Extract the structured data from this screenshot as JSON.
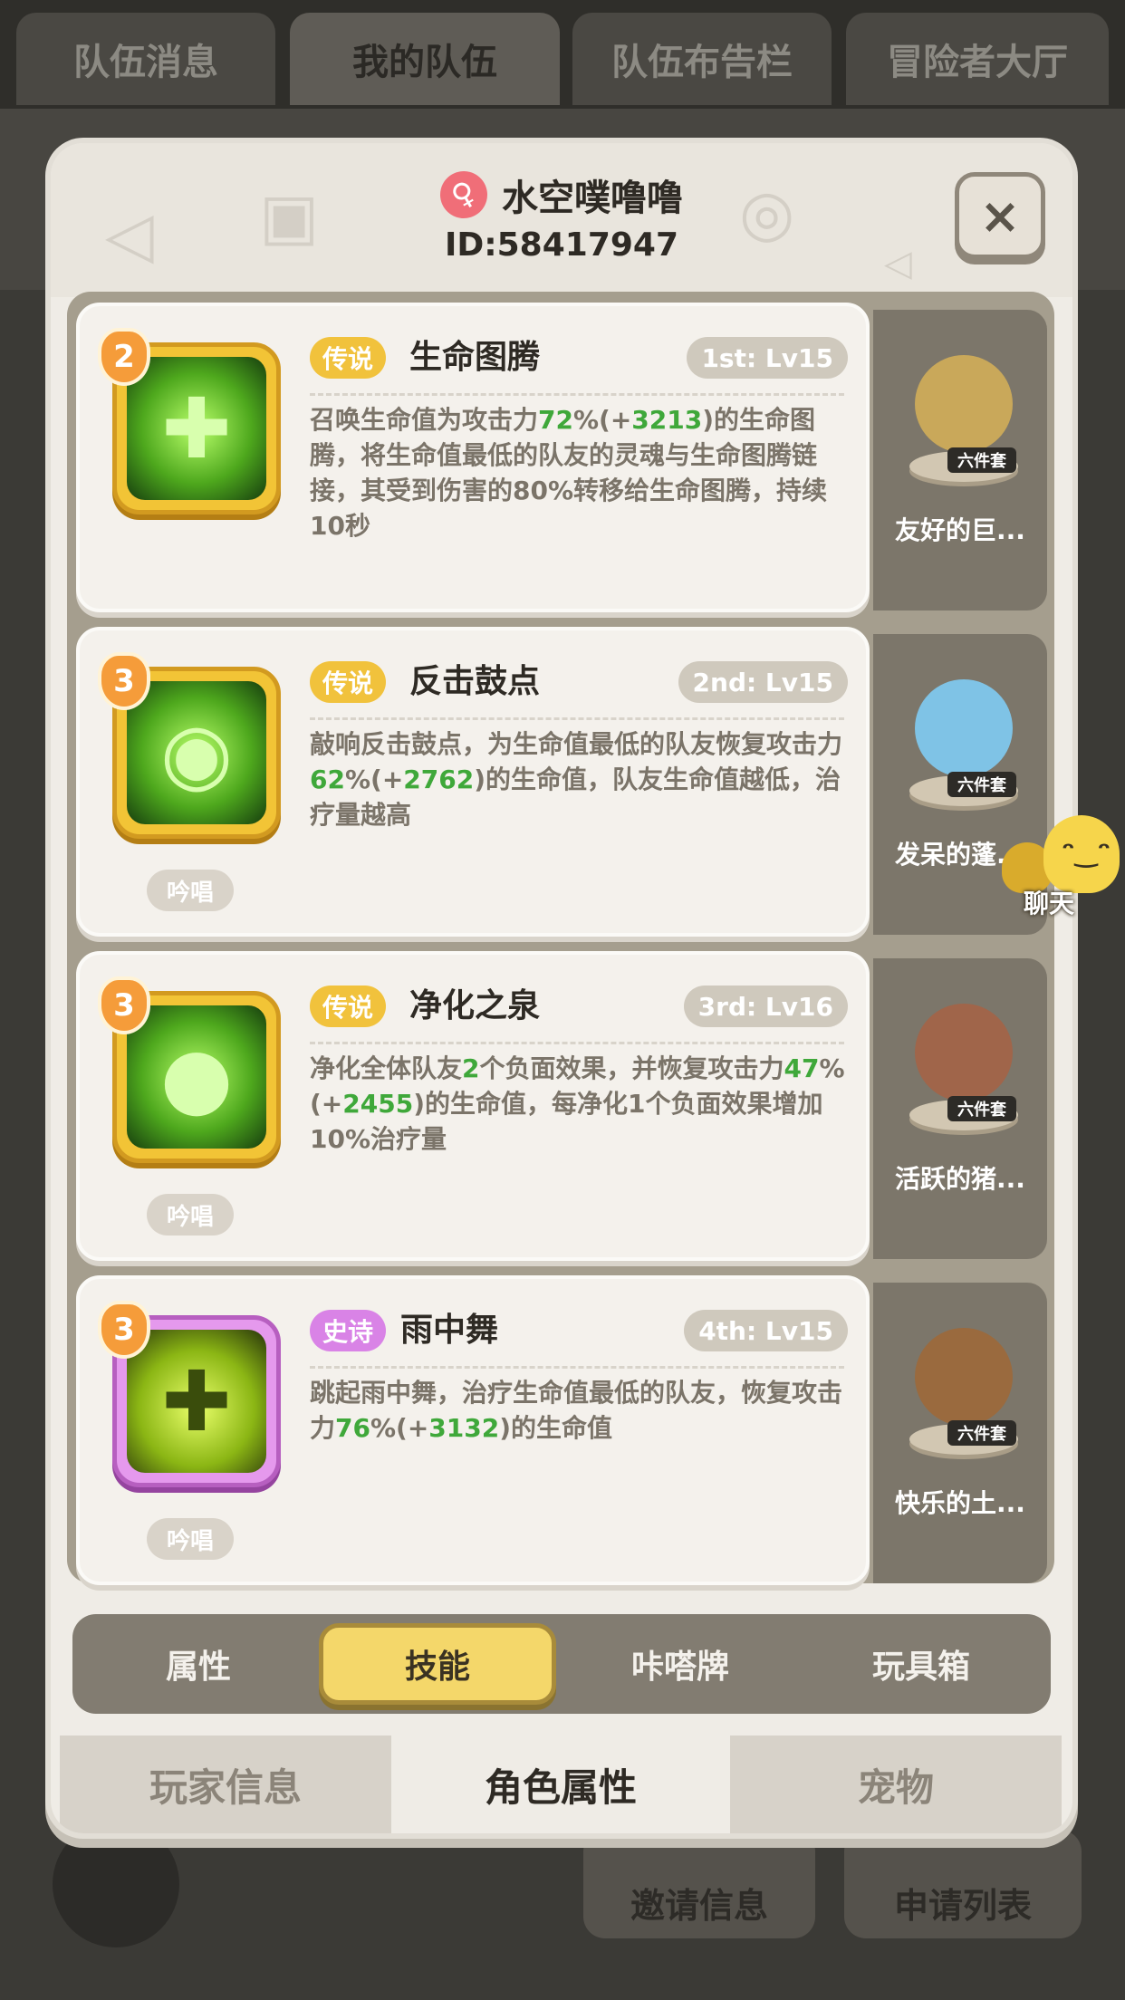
{
  "background": {
    "top_tabs": [
      "队伍消息",
      "我的队伍",
      "队伍布告栏",
      "冒险者大厅"
    ],
    "bottom_buttons": [
      "邀请信息",
      "申请列表"
    ]
  },
  "profile": {
    "name": "水空噗噜噜",
    "id": "ID:58417947",
    "close_label": "×"
  },
  "skills": [
    {
      "level": "2",
      "rarity": "传说",
      "name": "生命图腾",
      "rank": "1st: Lv15",
      "desc_parts": [
        "召唤生命值为攻击力",
        "72",
        "%(+",
        "3213",
        ")的生命图腾，将生命值最低的队友的灵魂与生命图腾链接，其受到伤害的80%转移给生命图腾，持续10秒"
      ],
      "cast": ""
    },
    {
      "level": "3",
      "rarity": "传说",
      "name": "反击鼓点",
      "rank": "2nd: Lv15",
      "desc_parts": [
        "敲响反击鼓点，为生命值最低的队友恢复攻击力",
        "62",
        "%(+",
        "2762",
        ")的生命值，队友生命值越低，治疗量越高"
      ],
      "cast": "吟唱"
    },
    {
      "level": "3",
      "rarity": "传说",
      "name": "净化之泉",
      "rank": "3rd: Lv16",
      "desc_parts": [
        "净化全体队友",
        "2",
        "个负面效果，并恢复攻击力",
        "47",
        "%(+",
        "2455",
        ")的生命值，每净化1个负面效果增加10%治疗量"
      ],
      "cast": "吟唱"
    },
    {
      "level": "3",
      "rarity": "史诗",
      "name": "雨中舞",
      "rank": "4th: Lv15",
      "desc_parts": [
        "跳起雨中舞，治疗生命值最低的队友，恢复攻击力",
        "76",
        "%(+",
        "3132",
        ")的生命值"
      ],
      "cast": "吟唱"
    }
  ],
  "pets": [
    {
      "name": "友好的巨...",
      "badge": "六件套",
      "color": "#c9a85a"
    },
    {
      "name": "发呆的蓬...",
      "badge": "六件套",
      "color": "#7fc3e6"
    },
    {
      "name": "活跃的猪...",
      "badge": "六件套",
      "color": "#a0654a"
    },
    {
      "name": "快乐的土...",
      "badge": "六件套",
      "color": "#9a6a3e"
    }
  ],
  "subtabs": [
    "属性",
    "技能",
    "咔嗒牌",
    "玩具箱"
  ],
  "bottom_tabs": [
    "玩家信息",
    "角色属性",
    "宠物"
  ],
  "chat": {
    "label": "聊天"
  },
  "colors": {
    "legendary": "#f1c23c",
    "epic": "#d983e6",
    "highlight_green": "#3fa83a"
  }
}
